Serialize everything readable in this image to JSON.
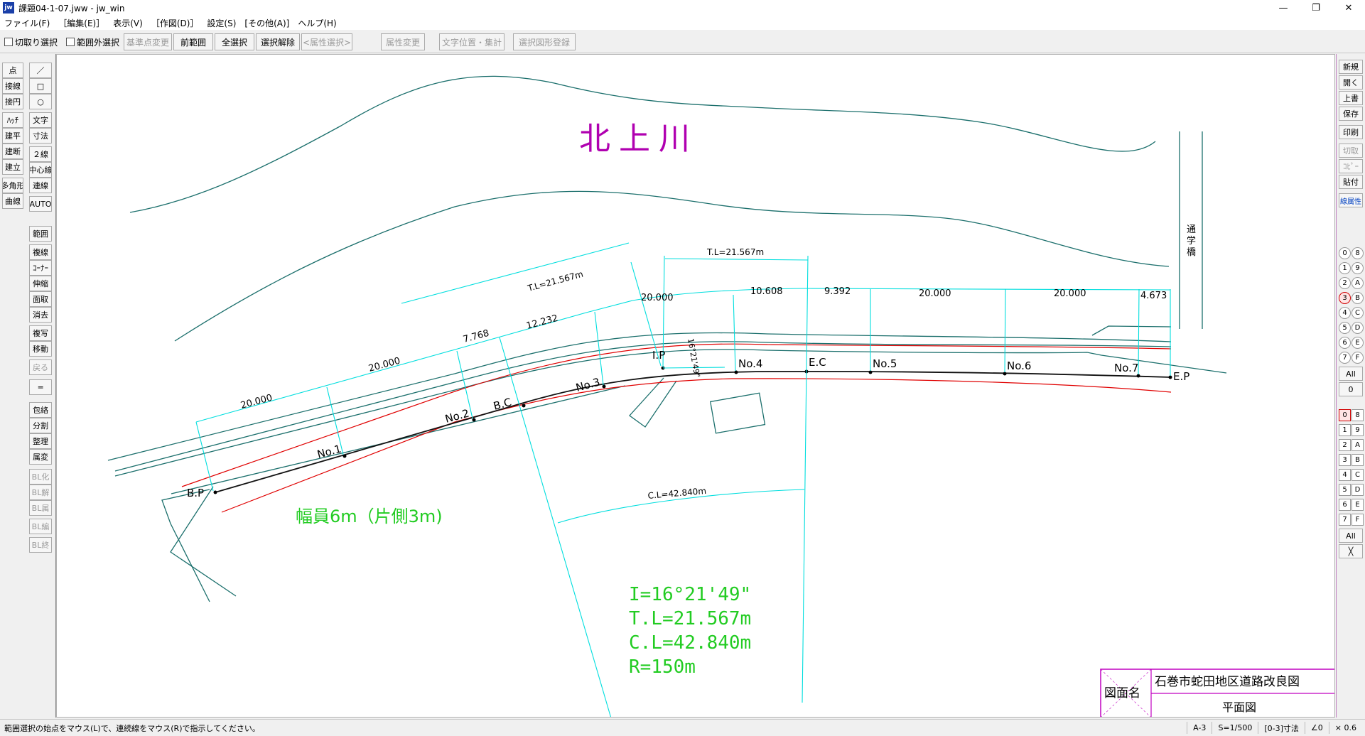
{
  "window": {
    "title": "課題04-1-07.jww - jw_win",
    "icon_label": "jw",
    "controls": [
      "—",
      "❐",
      "✕"
    ]
  },
  "menu": [
    "ファイル(F)",
    "［編集(E)］",
    "表示(V)",
    "［作図(D)］",
    "設定(S)",
    "[その他(A)]",
    "ヘルプ(H)"
  ],
  "toolbar": {
    "checkboxes": [
      "切取り選択",
      "範囲外選択"
    ],
    "buttons": [
      {
        "label": "基準点変更",
        "enabled": false
      },
      {
        "label": "前範囲",
        "enabled": true
      },
      {
        "label": "全選択",
        "enabled": true
      },
      {
        "label": "選択解除",
        "enabled": true
      },
      {
        "label": "<属性選択>",
        "enabled": false
      },
      {
        "label": "属性変更",
        "enabled": false
      },
      {
        "label": "文字位置・集計",
        "enabled": false
      },
      {
        "label": "選択図形登録",
        "enabled": false
      }
    ]
  },
  "left_tools": {
    "col1": [
      "点",
      "接線",
      "接円",
      "ﾊｯﾁ",
      "建平",
      "建断",
      "建立",
      "多角形",
      "曲線"
    ],
    "col2": [
      "／",
      "□",
      "○",
      "文字",
      "寸法",
      "２線",
      "中心線",
      "連線",
      "AUTO"
    ],
    "col2b": [
      {
        "label": "範囲",
        "enabled": true
      },
      {
        "label": "複線",
        "enabled": true
      },
      {
        "label": "ｺｰﾅｰ",
        "enabled": true
      },
      {
        "label": "伸縮",
        "enabled": true
      },
      {
        "label": "面取",
        "enabled": true
      },
      {
        "label": "消去",
        "enabled": true
      },
      {
        "label": "複写",
        "enabled": true
      },
      {
        "label": "移動",
        "enabled": true
      },
      {
        "label": "戻る",
        "enabled": false
      },
      {
        "label": "═",
        "enabled": true
      },
      {
        "label": "包絡",
        "enabled": true
      },
      {
        "label": "分割",
        "enabled": true
      },
      {
        "label": "整理",
        "enabled": true
      },
      {
        "label": "属変",
        "enabled": true
      },
      {
        "label": "BL化",
        "enabled": false
      },
      {
        "label": "BL解",
        "enabled": false
      },
      {
        "label": "BL属",
        "enabled": false
      },
      {
        "label": "BL編",
        "enabled": false
      },
      {
        "label": "BL終",
        "enabled": false
      }
    ]
  },
  "right_tools": [
    {
      "label": "新規",
      "enabled": true
    },
    {
      "label": "開く",
      "enabled": true
    },
    {
      "label": "上書",
      "enabled": true
    },
    {
      "label": "保存",
      "enabled": true
    },
    {
      "label": "印刷",
      "enabled": true
    },
    {
      "label": "切取",
      "enabled": false
    },
    {
      "label": "ｺﾋﾟｰ",
      "enabled": false
    },
    {
      "label": "貼付",
      "enabled": true
    },
    {
      "label": "線属性",
      "enabled": true
    }
  ],
  "layer_groups": {
    "left": [
      "0",
      "1",
      "2",
      "3",
      "4",
      "5",
      "6",
      "7"
    ],
    "right": [
      "8",
      "9",
      "A",
      "B",
      "C",
      "D",
      "E",
      "F"
    ],
    "active": "3",
    "all_label": "All",
    "zero_label": "0",
    "close_label": "╳"
  },
  "drawing": {
    "river_name": "北上川",
    "bridge_name": "通学橋",
    "points": [
      "B.P",
      "No.1",
      "No.2",
      "B.C",
      "No.3",
      "I.P",
      "No.4",
      "E.C",
      "No.5",
      "No.6",
      "No.7",
      "E.P"
    ],
    "dims": [
      "20.000",
      "20.000",
      "7.768",
      "12.232",
      "20.000",
      "10.608",
      "9.392",
      "20.000",
      "20.000",
      "4.673"
    ],
    "tl_label_1": "T.L=21.567m",
    "tl_label_2": "T.L=21.567m",
    "cl_label": "C.L=42.840m",
    "angle_label": "16°21'49\"",
    "width_note": "幅員6m（片側3m)",
    "curve_info": [
      "I=16°21'49\"",
      "T.L=21.567m",
      "C.L=42.840m",
      "R=150m"
    ],
    "title_block": {
      "label": "図面名",
      "project": "石巻市蛇田地区道路改良図",
      "sheet": "平面図"
    }
  },
  "status": {
    "message": "範囲選択の始点をマウス(L)で、連続線をマウス(R)で指示してください。",
    "paper": "A-3",
    "scale": "S=1/500",
    "layer": "[0-3]寸法",
    "angle": "∠0",
    "zoom": "× 0.6"
  },
  "colors": {
    "road": "#1b6f6c",
    "dim": "#00e5e5",
    "red": "#e00000",
    "river_text": "#b000b0",
    "green": "#22cc22",
    "frame": "#c000c0"
  }
}
